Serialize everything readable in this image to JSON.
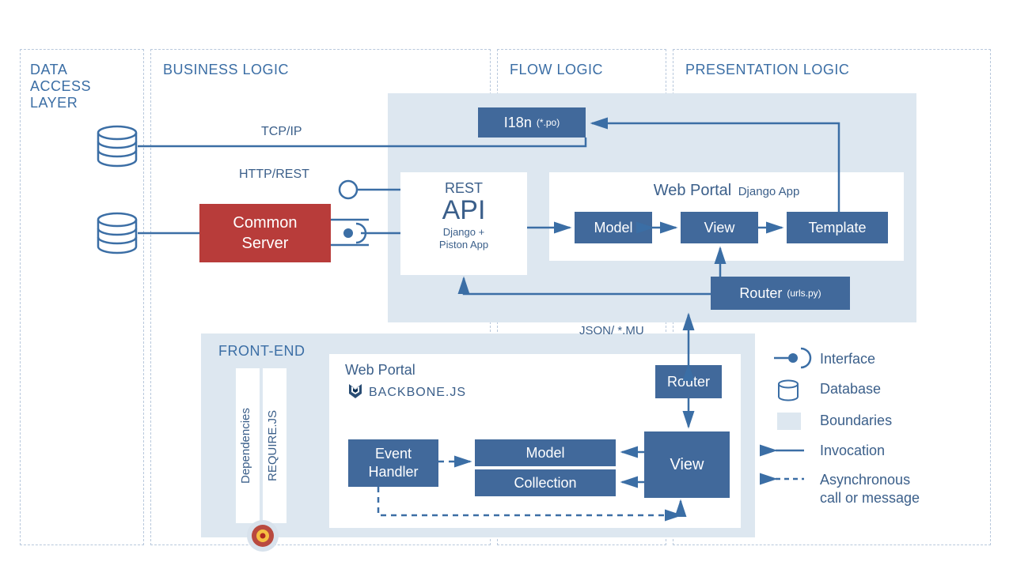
{
  "layers": {
    "data_access": "DATA\nACCESS\nLAYER",
    "business": "BUSINESS LOGIC",
    "flow": "FLOW LOGIC",
    "presentation": "PRESENTATION LOGIC",
    "frontend": "FRONT-END"
  },
  "labels": {
    "tcpip": "TCP/IP",
    "httprest": "HTTP/REST",
    "json_mu": "JSON/ *.MU"
  },
  "boxes": {
    "common_server": "Common\nServer",
    "i18n": "I18n",
    "i18n_sub": "(*.po)",
    "rest_api_title": "REST",
    "rest_api_big": "API",
    "rest_api_sub": "Django +\nPiston App",
    "web_portal_title": "Web Portal",
    "web_portal_sub": "Django App",
    "model": "Model",
    "view": "View",
    "template": "Template",
    "router": "Router",
    "router_sub": "(urls.py)",
    "fe_web_portal": "Web Portal",
    "fe_backbone": "BACKBONE.JS",
    "fe_router": "Router",
    "fe_view": "View",
    "fe_model": "Model",
    "fe_collection": "Collection",
    "fe_event": "Event\nHandler",
    "dependencies": "Dependencies",
    "requirejs": "REQUIRE.JS"
  },
  "legend": {
    "interface": "Interface",
    "database": "Database",
    "boundaries": "Boundaries",
    "invocation": "Invocation",
    "async": "Asynchronous\ncall or message"
  }
}
